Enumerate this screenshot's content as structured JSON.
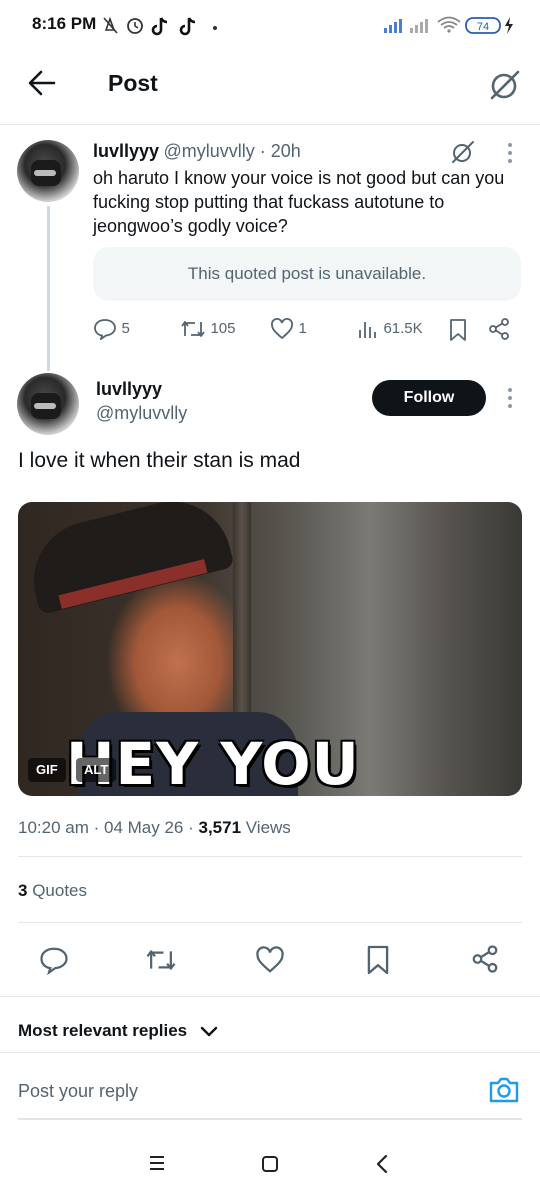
{
  "status_bar": {
    "time": "8:16 PM",
    "battery": "74"
  },
  "header": {
    "title": "Post"
  },
  "parent_tweet": {
    "display_name": "luvllyyy",
    "meta": "@myluvvlly · 20h",
    "text": "oh haruto I know your voice is not good but can you fucking stop putting that fuckass autotune to jeongwoo’s godly voice?",
    "quoted_unavailable": "This quoted post is unavailable.",
    "replies": "5",
    "reposts": "105",
    "likes": "1",
    "views": "61.5K"
  },
  "main_tweet": {
    "display_name": "luvllyyy",
    "handle": "@myluvvlly",
    "follow_label": "Follow",
    "text": "I love it when their stan is mad",
    "media_caption": "HEY YOU",
    "gif_badge": "GIF",
    "alt_badge": "ALT",
    "time_date": "10:20 am · 04 May 26 · ",
    "views_count": "3,571",
    "views_label": " Views",
    "quotes_count": "3",
    "quotes_label": " Quotes"
  },
  "replies_filter": {
    "label": "Most relevant replies"
  },
  "reply_box": {
    "placeholder": "Post your reply"
  },
  "colors": {
    "accent": "#1d9bf0",
    "text": "#0f1419",
    "muted": "#536471",
    "border": "#e3e8ec"
  }
}
